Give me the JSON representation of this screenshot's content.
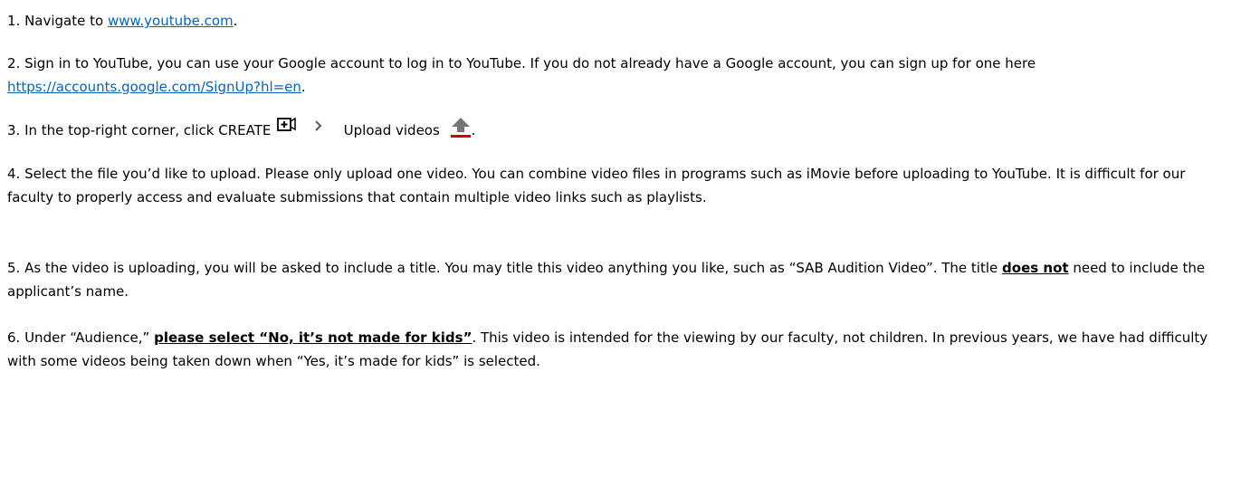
{
  "steps": [
    {
      "prefix": "1. Navigate to ",
      "link": "www.youtube.com",
      "suffix": "."
    },
    {
      "prefix": "2. Sign in to YouTube, you can use your Google account to log in to YouTube. If you do not already have a Google account, you can sign up for one here ",
      "link": "https://accounts.google.com/SignUp?hl=en",
      "suffix": "."
    },
    {
      "prefix": "3. In the top-right corner, click CREATE",
      "create_icon": "create-video-icon",
      "chevron_icon": "chevron-right-icon",
      "middle": "Upload videos",
      "upload_icon": "upload-arrow-icon",
      "suffix": "."
    },
    {
      "text": "4. Select the file you’d like to upload. Please only upload one video. You can combine video files in programs such as iMovie before uploading to YouTube. It is difficult for our faculty to properly access and evaluate submissions that contain multiple video links such as playlists."
    },
    {
      "prefix": "5. As the video is uploading, you will be asked to include a title. You may title this video anything you like, such as “SAB Audition Video”. The title ",
      "emphasis": "does not",
      "suffix": " need to include the applicant’s name."
    },
    {
      "prefix": "6. Under “Audience,” ",
      "emphasis": "please select “No, it’s not made for kids”",
      "suffix": ". This video is intended for the viewing by our faculty, not children. In previous years, we have had difficulty with some videos being taken down when “Yes, it’s made for kids” is selected."
    }
  ],
  "colors": {
    "link": "#0563c1",
    "upload_arrow": "#757575",
    "upload_bar": "#cc0000",
    "icon_stroke": "#606060"
  }
}
